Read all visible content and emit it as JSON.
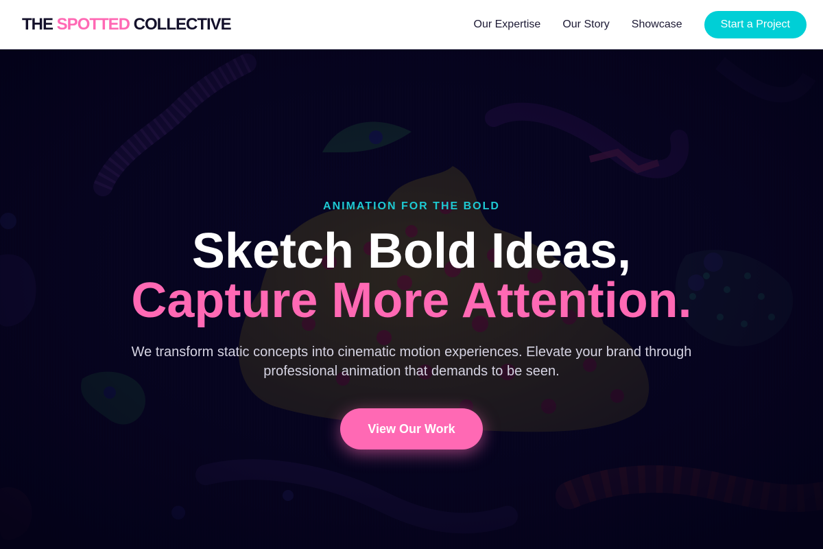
{
  "header": {
    "logo": {
      "part1": "THE ",
      "part2": "SPOTTED",
      "part3": " COLLECTIVE"
    },
    "nav": [
      {
        "label": "Our Expertise"
      },
      {
        "label": "Our Story"
      },
      {
        "label": "Showcase"
      }
    ],
    "cta_label": "Start a Project"
  },
  "hero": {
    "eyebrow": "ANIMATION FOR THE BOLD",
    "headline_line1": "Sketch Bold Ideas,",
    "headline_line2": "Capture More Attention.",
    "subtitle": "We transform static concepts into cinematic motion experiences. Elevate your brand through professional animation that demands to be seen.",
    "button_label": "View Our Work"
  },
  "colors": {
    "accent_pink": "#ff69b4",
    "accent_cyan": "#00cfd6",
    "hero_background": "#050318",
    "header_background": "#ffffff",
    "text_dark": "#14112b"
  }
}
